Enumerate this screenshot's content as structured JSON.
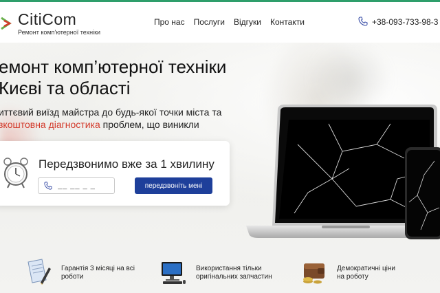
{
  "header": {
    "brand": "CitiCom",
    "tagline": "Ремонт комп'ютерної техніки",
    "nav": [
      "Про нас",
      "Послуги",
      "Відгуки",
      "Контакти"
    ],
    "phone": "+38-093-733-98-3"
  },
  "hero": {
    "title_line1": "емонт комп’ютерної техніки",
    "title_line2": "Києві та області",
    "sub_line1": "иттєвий виїзд майстра до будь-якої точки міста та",
    "sub_line2_accent": "зкоштовна діагностика",
    "sub_line2_rest": " проблем, що виникли"
  },
  "callback": {
    "title": "Передзвонимо вже за 1 хвилину",
    "phone_placeholder": "__ __ _ _",
    "button_label": "передзвоніть мені"
  },
  "features": [
    {
      "icon": "document-pen-icon",
      "line1": "Гарантія 3 місяці на всі",
      "line2": "роботи"
    },
    {
      "icon": "computer-icon",
      "line1": "Використання тільки",
      "line2": "оригінальних запчастин"
    },
    {
      "icon": "wallet-coins-icon",
      "line1": "Демократичні ціни",
      "line2": "на роботу"
    }
  ],
  "colors": {
    "accent_red": "#d33b2c",
    "button_blue": "#1e3f9a",
    "top_line_green": "#2e9e6b"
  }
}
